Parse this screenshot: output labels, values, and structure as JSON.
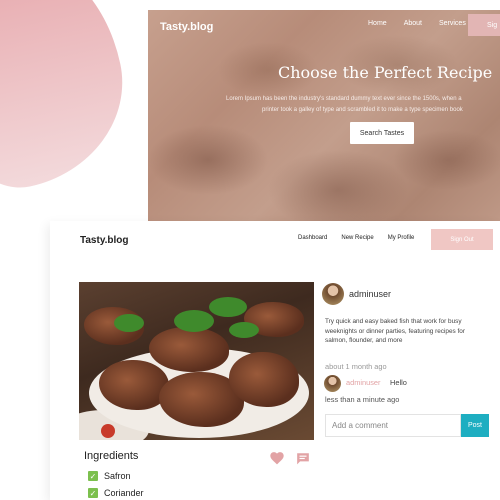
{
  "landing": {
    "logo": "Tasty.blog",
    "nav": [
      "Home",
      "About",
      "Services"
    ],
    "signin_label": "Sig",
    "title": "Choose the Perfect Recipe",
    "text_line1": "Lorem Ipsum has been the industry's standard dummy text ever since the 1500s, when a",
    "text_line2": "printer took a galley of type and scrambled it to make a type specimen book",
    "search_button": "Search Tastes"
  },
  "card": {
    "logo": "Tasty.blog",
    "nav": [
      "Dashboard",
      "New Recipe",
      "My Profile"
    ],
    "signout_label": "Sign Out",
    "ingredients_title": "Ingredients",
    "ingredients": [
      "Safron",
      "Coriander"
    ],
    "post": {
      "username": "adminuser",
      "text": "Try quick and easy baked fish that work for busy weeknights or dinner parties, featuring recipes for salmon, flounder, and more",
      "time": "about 1 month ago"
    },
    "comment": {
      "username": "adminuser",
      "text": "Hello",
      "time": "less than a minute ago"
    },
    "comment_input_placeholder": "Add a comment",
    "post_button": "Post"
  },
  "colors": {
    "accent_pink": "#f0c7c4",
    "post_button": "#1eaec1",
    "check_green": "#7cc04e",
    "heart": "#e2a3a5"
  },
  "icons": [
    "heart-icon",
    "comment-icon",
    "check-icon"
  ]
}
